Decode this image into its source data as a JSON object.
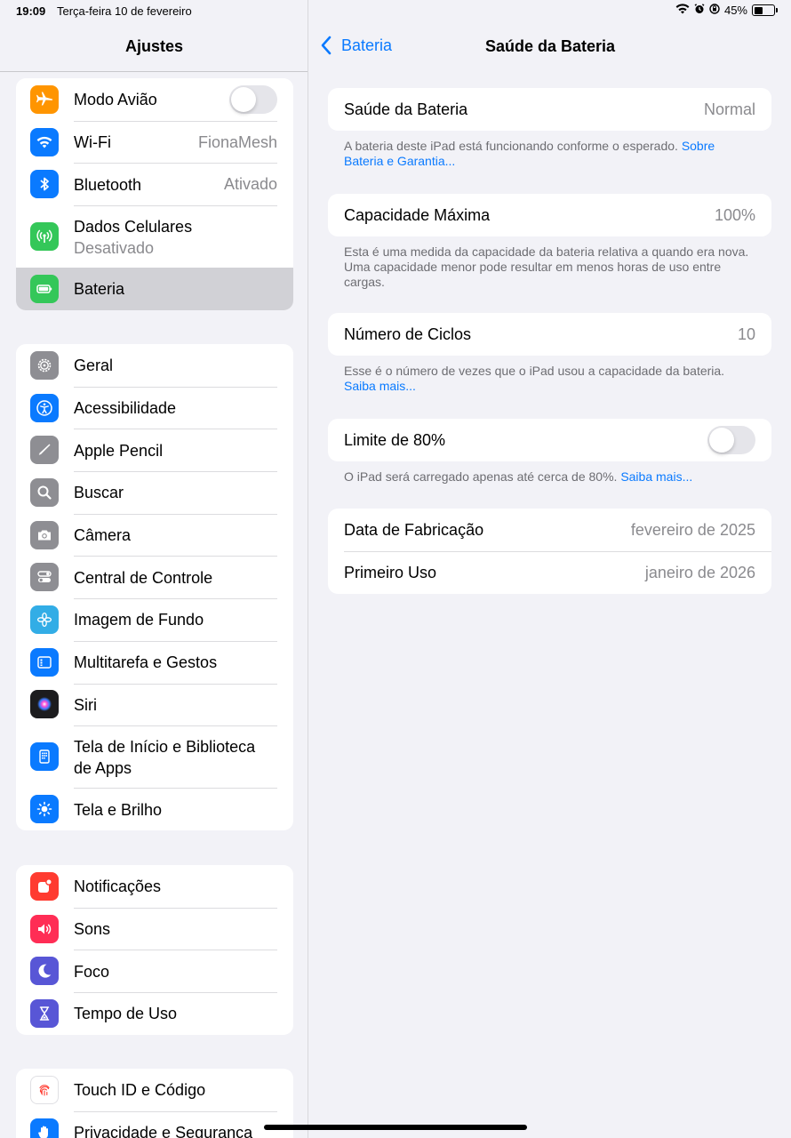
{
  "status": {
    "time": "19:09",
    "date": "Terça-feira 10 de fevereiro",
    "battery": "45%",
    "battery_level": 0.45
  },
  "sidebar": {
    "title": "Ajustes",
    "group1": [
      {
        "label": "Modo Avião",
        "icon": "airplane-icon",
        "color": "#ff9500",
        "toggle": false
      },
      {
        "label": "Wi-Fi",
        "value": "FionaMesh",
        "icon": "wifi-icon",
        "color": "#0a7aff"
      },
      {
        "label": "Bluetooth",
        "value": "Ativado",
        "icon": "bluetooth-icon",
        "color": "#0a7aff"
      },
      {
        "label": "Dados Celulares",
        "sub": "Desativado",
        "icon": "cellular-icon",
        "color": "#34c759"
      },
      {
        "label": "Bateria",
        "icon": "battery-icon",
        "color": "#34c759",
        "selected": true
      }
    ],
    "group2": [
      {
        "label": "Geral",
        "icon": "gear-icon",
        "color": "#8e8e93"
      },
      {
        "label": "Acessibilidade",
        "icon": "accessibility-icon",
        "color": "#0a7aff"
      },
      {
        "label": "Apple Pencil",
        "icon": "pencil-icon",
        "color": "#8e8e93"
      },
      {
        "label": "Buscar",
        "icon": "search-icon",
        "color": "#8e8e93"
      },
      {
        "label": "Câmera",
        "icon": "camera-icon",
        "color": "#8e8e93"
      },
      {
        "label": "Central de Controle",
        "icon": "control-center-icon",
        "color": "#8e8e93"
      },
      {
        "label": "Imagem de Fundo",
        "icon": "wallpaper-icon",
        "color": "#32ade6"
      },
      {
        "label": "Multitarefa e Gestos",
        "icon": "multitasking-icon",
        "color": "#0a7aff"
      },
      {
        "label": "Siri",
        "icon": "siri-icon",
        "color": "#1c1c1e"
      },
      {
        "label": "Tela de Início e Biblioteca de Apps",
        "icon": "home-screen-icon",
        "color": "#0a7aff"
      },
      {
        "label": "Tela e Brilho",
        "icon": "brightness-icon",
        "color": "#0a7aff"
      }
    ],
    "group3": [
      {
        "label": "Notificações",
        "icon": "notifications-icon",
        "color": "#ff3b30"
      },
      {
        "label": "Sons",
        "icon": "sounds-icon",
        "color": "#ff2d55"
      },
      {
        "label": "Foco",
        "icon": "moon-icon",
        "color": "#5856d6"
      },
      {
        "label": "Tempo de Uso",
        "icon": "hourglass-icon",
        "color": "#5856d6"
      }
    ],
    "group4": [
      {
        "label": "Touch ID e Código",
        "icon": "fingerprint-icon",
        "color": "#ffffff"
      },
      {
        "label": "Privacidade e Segurança",
        "icon": "hand-icon",
        "color": "#0a7aff"
      }
    ]
  },
  "detail": {
    "back_label": "Bateria",
    "title": "Saúde da Bateria",
    "health": {
      "label": "Saúde da Bateria",
      "value": "Normal"
    },
    "health_note": {
      "text": "A bateria deste iPad está funcionando conforme o esperado. ",
      "link": "Sobre Bateria e Garantia..."
    },
    "capacity": {
      "label": "Capacidade Máxima",
      "value": "100%"
    },
    "capacity_note": "Esta é uma medida da capacidade da bateria relativa a quando era nova. Uma capacidade menor pode resultar em menos horas de uso entre cargas.",
    "cycles": {
      "label": "Número de Ciclos",
      "value": "10"
    },
    "cycles_note": {
      "text": "Esse é o número de vezes que o iPad usou a capacidade da bateria. ",
      "link": "Saiba mais..."
    },
    "limit": {
      "label": "Limite de 80%",
      "toggle": false
    },
    "limit_note": {
      "text": "O iPad será carregado apenas até cerca de 80%. ",
      "link": "Saiba mais..."
    },
    "manufacture": {
      "label": "Data de Fabricação",
      "value": "fevereiro de 2025"
    },
    "first_use": {
      "label": "Primeiro Uso",
      "value": "janeiro de 2026"
    }
  }
}
